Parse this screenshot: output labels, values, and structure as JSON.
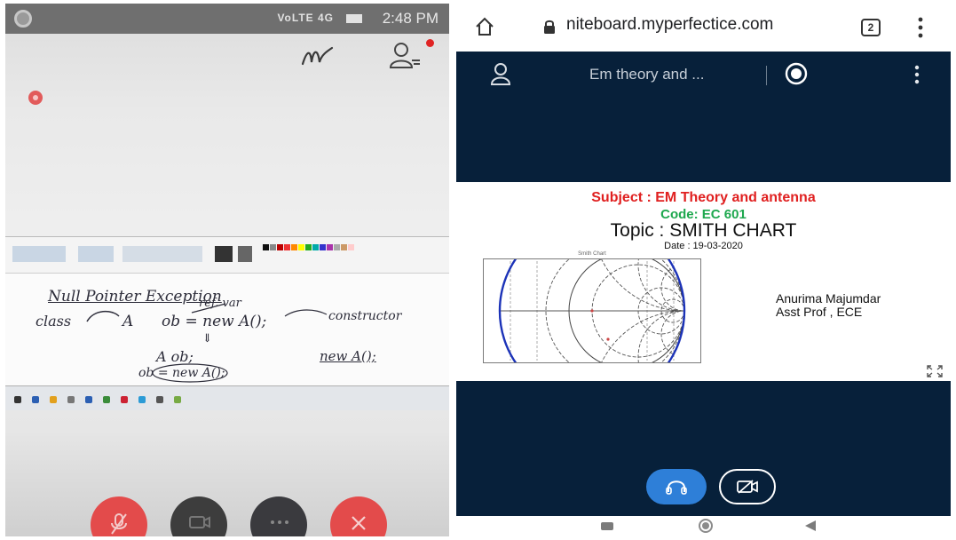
{
  "left_phone": {
    "status_bar": {
      "network": "VoLTE 4G",
      "time": "2:48 PM"
    },
    "whiteboard_text": {
      "line1": "Null Pointer Exception",
      "class_word": "class",
      "class_name": "A",
      "ref_var_note": "ref. var",
      "statement1": "ob = new A();",
      "constructor_note": "constructor",
      "down_arrow": "⇓",
      "decl": "A ob;",
      "assign": "ob = new A();",
      "side_expr": "new A();"
    },
    "controls": {
      "mic": "mic-off",
      "camera": "camera-off",
      "more": "more",
      "leave": "leave"
    },
    "colors": {
      "red_button": "#e34b4b",
      "dark_button": "#3d3d3d"
    }
  },
  "right_phone": {
    "browser": {
      "url": "niteboard.myperfectice.com",
      "tab_count": "2"
    },
    "meeting": {
      "title": "Em theory and ..."
    },
    "slide": {
      "subject": "Subject : EM Theory and antenna",
      "code": "Code: EC 601",
      "topic": "Topic : SMITH CHART",
      "date": "Date : 19-03-2020",
      "chart_caption": "Smith Chart",
      "author_name": "Anurima Majumdar",
      "author_title": "Asst Prof , ECE"
    },
    "colors": {
      "background": "#07203a",
      "audio_button": "#2e7fd8",
      "subject_red": "#e02020",
      "code_green": "#1fa84f",
      "smith_blue": "#1c33b8"
    }
  }
}
